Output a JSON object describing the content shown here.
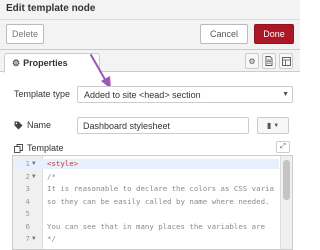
{
  "header": {
    "title": "Edit template node"
  },
  "actions": {
    "delete_label": "Delete",
    "cancel_label": "Cancel",
    "done_label": "Done"
  },
  "tabs": {
    "properties_label": "Properties"
  },
  "form": {
    "template_type_label": "Template type",
    "template_type_value": "Added to site <head> section",
    "name_label": "Name",
    "name_value": "Dashboard stylesheet",
    "template_label": "Template"
  },
  "editor": {
    "lines": [
      {
        "num": "1",
        "text": "<style>",
        "fold": true,
        "tag": true,
        "active": true
      },
      {
        "num": "2",
        "text": "/*",
        "fold": true
      },
      {
        "num": "3",
        "text": "It is reasonable to declare the colors as CSS varia"
      },
      {
        "num": "4",
        "text": "so they can be easily called by name where needed."
      },
      {
        "num": "5",
        "text": ""
      },
      {
        "num": "6",
        "text": "You can see that in many places the variables are"
      },
      {
        "num": "7",
        "text": "*/",
        "fold": true
      }
    ]
  },
  "colors": {
    "done_button": "#ad1625",
    "annotation_arrow": "#9b59b6",
    "tag_text": "#c0392b"
  },
  "icons": {
    "properties_tab": "gear-icon",
    "tab_description": "file-icon",
    "tab_appearance": "layout-icon",
    "name_field": "tag-icon",
    "template_field": "copy-icon",
    "name_menu": "book-icon",
    "expand_editor": "expand-icon"
  }
}
